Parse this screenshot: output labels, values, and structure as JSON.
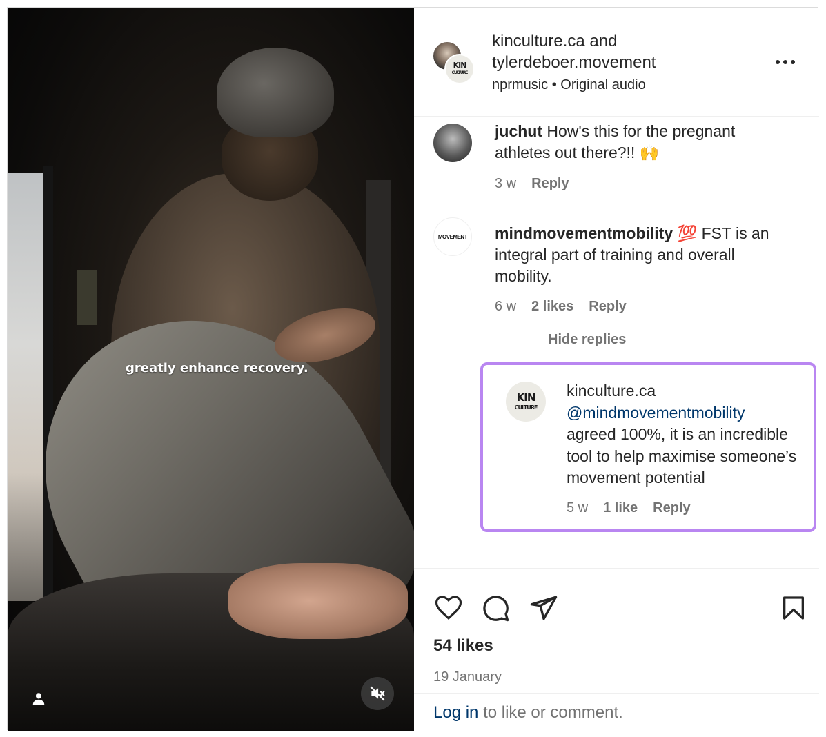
{
  "video": {
    "caption": "greatly enhance recovery.",
    "user_icon": "user-icon",
    "mute_icon": "muted-speaker-icon"
  },
  "post": {
    "owner_primary": "kinculture.ca",
    "owner_joiner": "and",
    "owner_secondary": "tylerdeboer.movement",
    "audio_artist": "nprmusic",
    "audio_separator": "•",
    "audio_label": "Original audio",
    "avatar_logo": "KIN CULTURE",
    "more_icon": "more-horizontal-icon"
  },
  "comments": [
    {
      "user": "juchut",
      "text": "How's this for the pregnant athletes out there?!! 🙌",
      "time": "3 w",
      "likes": "",
      "reply": "Reply"
    },
    {
      "user": "mindmovementmobility",
      "emoji": "💯",
      "text": "FST is an integral part of training and overall mobility.",
      "avatar_logo": "MOVEMENT",
      "time": "6 w",
      "likes": "2 likes",
      "reply": "Reply"
    }
  ],
  "hide_replies": "Hide replies",
  "reply": {
    "user": "kinculture.ca",
    "mention": "@mindmovementmobility",
    "text": "agreed 100%, it is an incredible tool to help maximise someone’s movement potential",
    "avatar_logo": "KIN CULTURE",
    "time": "5 w",
    "likes": "1 like",
    "reply": "Reply",
    "highlight_color": "#b986f1"
  },
  "actions": {
    "like_icon": "heart-icon",
    "comment_icon": "comment-icon",
    "share_icon": "share-icon",
    "save_icon": "bookmark-icon",
    "likes_count": "54 likes",
    "date": "19 January"
  },
  "login": {
    "link": "Log in",
    "rest": "to like or comment."
  },
  "colors": {
    "link": "#00376b",
    "secondary_text": "#737373",
    "primary_text": "#262626"
  }
}
